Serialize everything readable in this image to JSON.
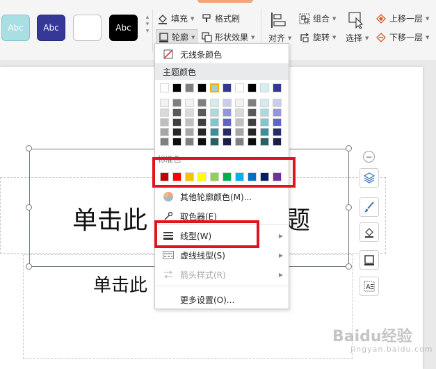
{
  "ribbon": {
    "style_tiles": [
      {
        "label": "Abc",
        "bg": "#a9dfe3",
        "fg": "#ffffff",
        "border": "#7cc6cc"
      },
      {
        "label": "Abc",
        "bg": "#353896",
        "fg": "#ffffff",
        "border": "#25287a"
      },
      {
        "label": "",
        "bg": "#ffffff",
        "fg": "#333333",
        "border": "#bfbfbf"
      },
      {
        "label": "Abc",
        "bg": "#000000",
        "fg": "#ffffff",
        "border": "#000000"
      }
    ],
    "fill_label": "填充",
    "format_brush_label": "格式刷",
    "outline_label": "轮廓",
    "shape_effect_label": "形状效果",
    "align_label": "对齐",
    "group_label": "组合",
    "rotate_label": "旋转",
    "select_label": "选择",
    "bring_forward_label": "上移一层",
    "send_backward_label": "下移一层"
  },
  "slide": {
    "title_left": "单击此",
    "title_right": "题",
    "subtitle_left": "单击此"
  },
  "outline_menu": {
    "no_line_label": "无线条颜色",
    "theme_colors_header": "主题颜色",
    "theme_top_row": [
      "#ffffff",
      "#000000",
      "#7f7f7f",
      "#000000",
      "#9fd0d6",
      "#34398f",
      "#ffffff",
      "#000000",
      "#d6eef0",
      "#34398f"
    ],
    "theme_shade_rows": [
      [
        "#f2f2f2",
        "#7f7f7f",
        "#f2f2f2",
        "#7f7f7f",
        "#d5ecee",
        "#c9cbef",
        "#f2f2f2",
        "#7f7f7f",
        "#d5ecee",
        "#c9cbef"
      ],
      [
        "#d9d9d9",
        "#595959",
        "#d9d9d9",
        "#595959",
        "#abd9dd",
        "#9396de",
        "#d9d9d9",
        "#595959",
        "#abd9dd",
        "#9396de"
      ],
      [
        "#bfbfbf",
        "#3f3f3f",
        "#bfbfbf",
        "#3f3f3f",
        "#81c6cc",
        "#5d62cd",
        "#bfbfbf",
        "#3f3f3f",
        "#81c6cc",
        "#5d62cd"
      ],
      [
        "#a6a6a6",
        "#262626",
        "#a6a6a6",
        "#262626",
        "#3b8f96",
        "#272b6b",
        "#a6a6a6",
        "#262626",
        "#3b8f96",
        "#272b6b"
      ],
      [
        "#7f7f7f",
        "#0d0d0d",
        "#7f7f7f",
        "#0d0d0d",
        "#275f64",
        "#1a1d47",
        "#7f7f7f",
        "#0d0d0d",
        "#275f64",
        "#1a1d47"
      ]
    ],
    "standard_colors_header": "标准色",
    "standard_colors": [
      "#c00000",
      "#ff0000",
      "#ffc000",
      "#ffff00",
      "#92d050",
      "#00b050",
      "#00b0f0",
      "#0070c0",
      "#002060",
      "#7030a0"
    ],
    "other_outline_color_label": "其他轮廓颜色(M)...",
    "eyedropper_label": "取色器(E)",
    "line_type_label": "线型(W)",
    "dash_type_label": "虚线线型(S)",
    "arrow_style_label": "箭头样式(R)",
    "more_settings_label": "更多设置(O)..."
  },
  "side_toolbar": {
    "icons": [
      "layers-icon",
      "brush-icon",
      "fill-icon",
      "outline-icon",
      "text-box-icon"
    ]
  },
  "watermark": {
    "brand": "Baidu经验",
    "url": "jingyan.baidu.com"
  },
  "colors": {
    "highlight_red": "#e0141e",
    "selected_swatch_border": "#f0b000"
  }
}
